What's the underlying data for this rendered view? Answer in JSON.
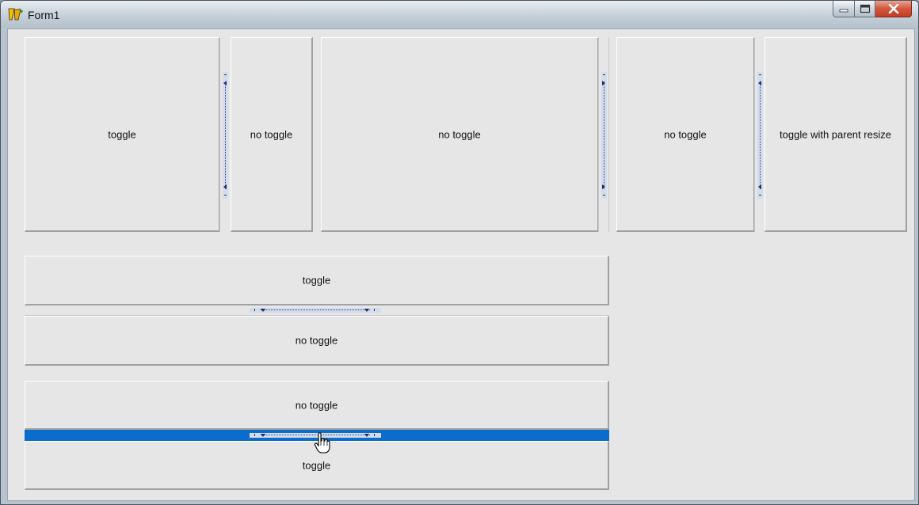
{
  "window": {
    "title": "Form1",
    "minimize_icon": "minimize-icon",
    "maximize_icon": "maximize-icon",
    "close_icon": "close-icon",
    "close_color": "#c13e24"
  },
  "top_row": {
    "group1": {
      "left_label": "toggle",
      "right_label": "no toggle"
    },
    "group2": {
      "left_label": "no toggle"
    },
    "group3": {
      "left_label": "no toggle",
      "right_label": "toggle with parent resize"
    }
  },
  "bottom_groups": {
    "group4": {
      "top_label": "toggle",
      "bottom_label": "no toggle"
    },
    "group5": {
      "top_label": "no toggle",
      "bottom_label": "toggle",
      "splitter_state": "active",
      "highlight_color": "#0a6ccd"
    }
  },
  "cursor": "hand-pointer-icon"
}
